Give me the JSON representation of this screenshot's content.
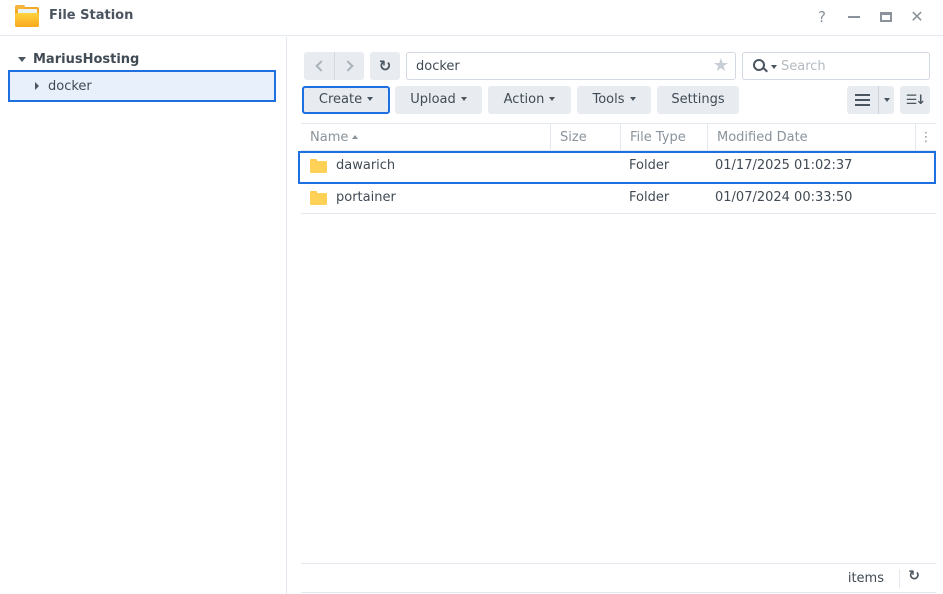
{
  "window": {
    "title": "File Station",
    "controls": {
      "help": "?",
      "close": "✕"
    }
  },
  "sidebar": {
    "root": {
      "label": "MariusHosting",
      "expanded": true
    },
    "items": [
      {
        "label": "docker",
        "selected": true,
        "expanded": false
      }
    ]
  },
  "toolbar": {
    "back_icon": "chevron-left-icon",
    "forward_icon": "chevron-right-icon",
    "refresh_glyph": "↻",
    "path": "docker",
    "favorite_glyph": "★",
    "search": {
      "placeholder": "Search",
      "value": ""
    },
    "buttons": {
      "create": "Create",
      "upload": "Upload",
      "action": "Action",
      "tools": "Tools",
      "settings": "Settings"
    },
    "sort_glyph": "☰↓"
  },
  "table": {
    "columns": {
      "name": "Name",
      "size": "Size",
      "type": "File Type",
      "modified": "Modified Date",
      "more": "⋮"
    },
    "sort": {
      "column": "name",
      "direction": "ascending"
    },
    "rows": [
      {
        "name": "dawarich",
        "size": "",
        "type": "Folder",
        "modified": "01/17/2025 01:02:37",
        "selected": true
      },
      {
        "name": "portainer",
        "size": "",
        "type": "Folder",
        "modified": "01/07/2024 00:33:50",
        "selected": false
      }
    ]
  },
  "footer": {
    "items_label": "items",
    "refresh_glyph": "↻"
  },
  "colors": {
    "accent": "#1e6fe0",
    "selection_bg": "#e8f1fb",
    "button_bg": "#e8ecf1",
    "folder": "#ffd257"
  }
}
